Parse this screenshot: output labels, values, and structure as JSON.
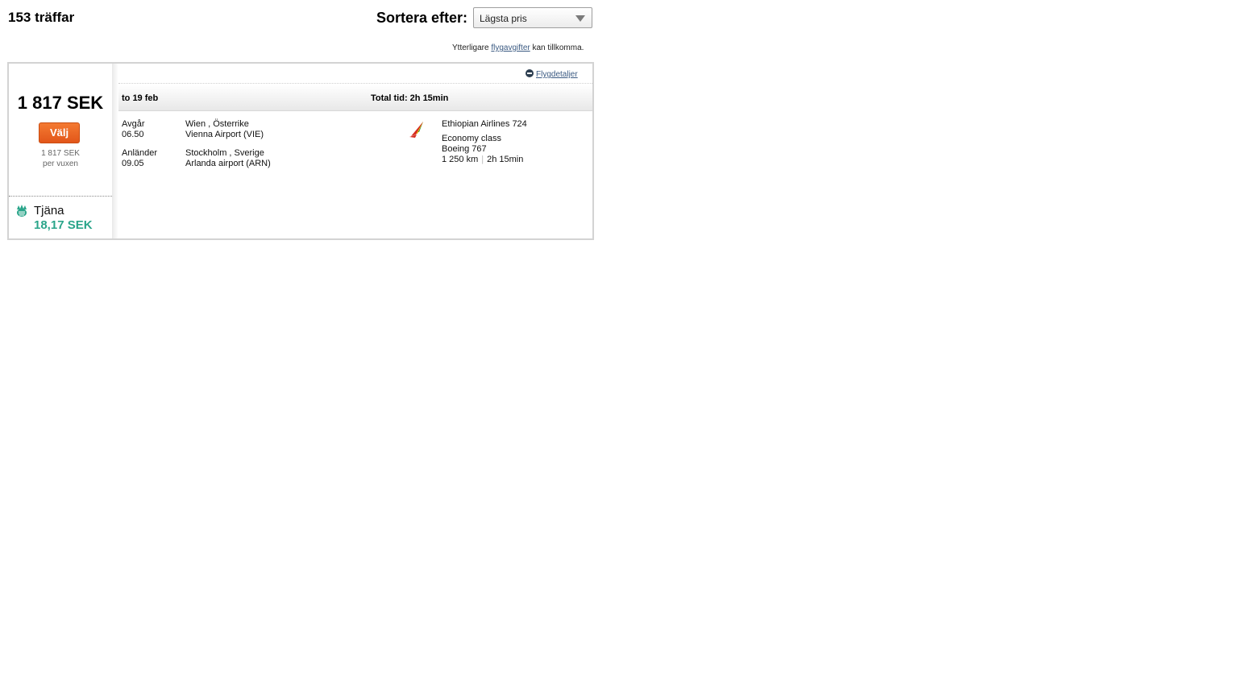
{
  "results": {
    "count_label": "153 träffar"
  },
  "sort": {
    "label": "Sortera efter:",
    "selected": "Lägsta pris"
  },
  "fees_note": {
    "prefix": "Ytterligare",
    "link": "flygavgifter",
    "suffix": "kan tillkomma."
  },
  "offer": {
    "price": "1 817 SEK",
    "select_label": "Välj",
    "per_price": "1 817 SEK",
    "per_label": "per vuxen",
    "earn_label": "Tjäna",
    "earn_amount": "18,17 SEK",
    "details_link": "Flygdetaljer",
    "date": "to 19 feb",
    "total_time": "Total tid: 2h 15min",
    "departure": {
      "label": "Avgår",
      "time": "06.50",
      "city": "Wien , Österrike",
      "airport": "Vienna Airport (VIE)"
    },
    "arrival": {
      "label": "Anländer",
      "time": "09.05",
      "city": "Stockholm , Sverige",
      "airport": "Arlanda airport (ARN)"
    },
    "airline": "Ethiopian Airlines 724",
    "cabin": "Economy class",
    "aircraft": "Boeing 767",
    "distance": "1 250 km",
    "duration": "2h 15min",
    "logo_icon": "ethiopian-airlines-logo-icon"
  },
  "colors": {
    "select_button": "#e2561a",
    "earn_amount": "#2aa58a",
    "link": "#3b5a82"
  }
}
